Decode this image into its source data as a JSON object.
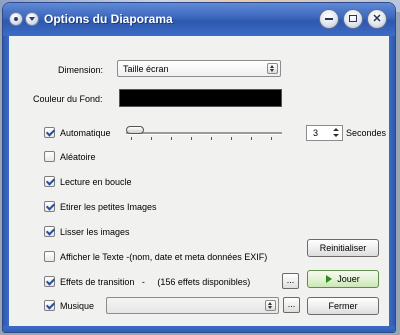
{
  "window": {
    "title": "Options du Diaporama"
  },
  "form": {
    "dimension_label": "Dimension:",
    "dimension_value": "Taille écran",
    "bgcolor_label": "Couleur du Fond:",
    "bgcolor_value": "#000000",
    "automatique_label": "Automatique",
    "automatique_checked": true,
    "seconds_value": "3",
    "seconds_label": "Secondes",
    "aleatoire_label": "Aléatoire",
    "aleatoire_checked": false,
    "loop_label": "Lecture en boucle",
    "loop_checked": true,
    "stretch_label": "Etirer les petites Images",
    "stretch_checked": true,
    "smooth_label": "Lisser les images",
    "smooth_checked": true,
    "showtext_label": "Afficher le Texte -(nom, date et meta données EXIF)",
    "showtext_checked": false,
    "effects_label": "Effets de transition   -     (156 effets disponibles)",
    "effects_checked": true,
    "music_label": "Musique",
    "music_checked": true,
    "music_value": ""
  },
  "buttons": {
    "reset": "Reinitialiser",
    "play": "Jouer",
    "close": "Fermer",
    "browse": "..."
  }
}
